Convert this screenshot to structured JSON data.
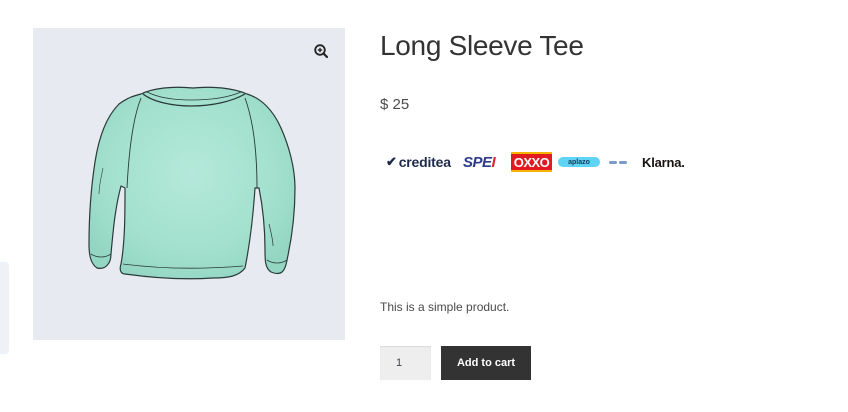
{
  "product": {
    "title": "Long Sleeve Tee",
    "price": "$ 25",
    "description": "This is a simple product.",
    "image": {
      "subject": "mint-green long sleeve tee illustration",
      "background_color": "#e7ebf1",
      "garment_color": "#a6e3d1"
    }
  },
  "gallery": {
    "zoom_icon": "magnifier-plus-icon"
  },
  "payment_logos": {
    "creditea": "creditea",
    "spei_main": "SPE",
    "spei_dot": "I",
    "oxxo": "OXXO",
    "aplazo": "aplazo",
    "klarna": "Klarna."
  },
  "cart": {
    "quantity": "1",
    "add_to_cart_label": "Add to cart"
  },
  "colors": {
    "button_bg": "#333333",
    "input_bg": "#eeeeee",
    "text": "#333333"
  }
}
